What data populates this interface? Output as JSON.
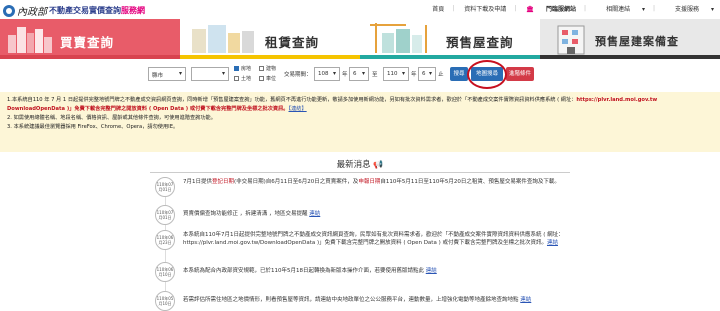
{
  "header": {
    "logo_ministry": "內政部",
    "logo_system_prefix": "不動產交易實價查詢",
    "logo_system_suffix": "服務網",
    "nav": [
      "首頁",
      "資料下載及申請",
      "門臨服網站",
      "相關連結",
      "支援服務"
    ]
  },
  "tabs": [
    {
      "label": "買賣查詢"
    },
    {
      "label": "租賃查詢"
    },
    {
      "label": "預售屋查詢"
    },
    {
      "label": "預售屋建案備查"
    }
  ],
  "search": {
    "city": "縣市",
    "district": "",
    "checkboxes": [
      {
        "label": "房地",
        "checked": true
      },
      {
        "label": "土地",
        "checked": false
      },
      {
        "label": "建物",
        "checked": false
      },
      {
        "label": "車位",
        "checked": false
      }
    ],
    "period_label": "交易期間：",
    "start_year": "108",
    "year_label": "年",
    "start_month": "6",
    "to_label": "至",
    "end_year": "110",
    "end_month": "6",
    "month_label": "止",
    "search_button": "搜尋",
    "map_button": "地圖搜尋",
    "advanced_button": "進階條件"
  },
  "notice": {
    "line1_a": "1.本系統自110 年 7 月 1 日起提供完整地號門牌之不動產成交資訊網頁查詢，同時新增「預售屋建案查詢」功能，舊網頁不再進行功能更新，敬請多加使用新網功能，另如有批次資料需求者，歡迎於「不動產成交案件實際資訊資料供應系統 ( 網址：",
    "line1_b": "https://plvr.land.moi.gov.tw DownloadOpenData )」",
    "line1_c": "免費下載含完整門牌之開放資料 ( Open Data ) 或付費下載含完整門牌及坐標之批次資訊。",
    "line1_link": "【連結】",
    "line2": "2. 如需使用總體名稱、地段名稱、價格資訊、屋齡或其他條件查詢，可使用進階查詢功能。",
    "line3": "3. 本系統建議最佳瀏覽器採用 FireFox、Chrome、Opera，請勿使用IE。"
  },
  "news": {
    "title": "最新消息",
    "items": [
      {
        "date": [
          "110年07",
          "月01日"
        ],
        "pre": "7月1日提供",
        "red1": "登記日期",
        "mid": "(非交易日期)自6月11日至6月20日之買賣案件，及",
        "red2": "申報日期",
        "post": "自110年5月11日至110年5月20日之租賃、預售屋交易案件查詢及下載。",
        "link": ""
      },
      {
        "date": [
          "110年07",
          "月01日"
        ],
        "pre": "買賣價偏查詢功能修正 ，拆建清溝 ，地區交易提醒 ",
        "red1": "",
        "mid": "",
        "red2": "",
        "post": "",
        "link": "連結"
      },
      {
        "date": [
          "110年06",
          "月23日"
        ],
        "pre": "本系統自110年7月1日起提供完整地號門牌之不動產成交資訊網頁查詢，民眾如有批次資料需求者，歡迎於「不動產成交案件實際資訊資料供應系統 ( 網址：https://plvr.land.moi.gov.tw/DownloadOpenData )」免費下載含完整門牌之開放資料 ( Open Data ) 或付費下載含完整門牌及坐標之批次資訊。",
        "red1": "",
        "mid": "",
        "red2": "",
        "post": "",
        "link": "連結"
      },
      {
        "date": [
          "110年06",
          "月10日"
        ],
        "pre": "本系統為配合內政部資安規範，已於110年5月18日起轉換為新版本操作介面，若要使用舊版請點此 ",
        "red1": "",
        "mid": "",
        "red2": "",
        "post": "",
        "link": "連結"
      },
      {
        "date": [
          "110年05",
          "月10日"
        ],
        "pre": "若需評估所需住地區之地價情形，則看預售屋等資訊，請連結中央地政單位之公公服務平台，連動數量，上增強化電動等地產餘地查詢地點 ",
        "red1": "",
        "mid": "",
        "red2": "",
        "post": "",
        "link": "連結"
      }
    ]
  }
}
